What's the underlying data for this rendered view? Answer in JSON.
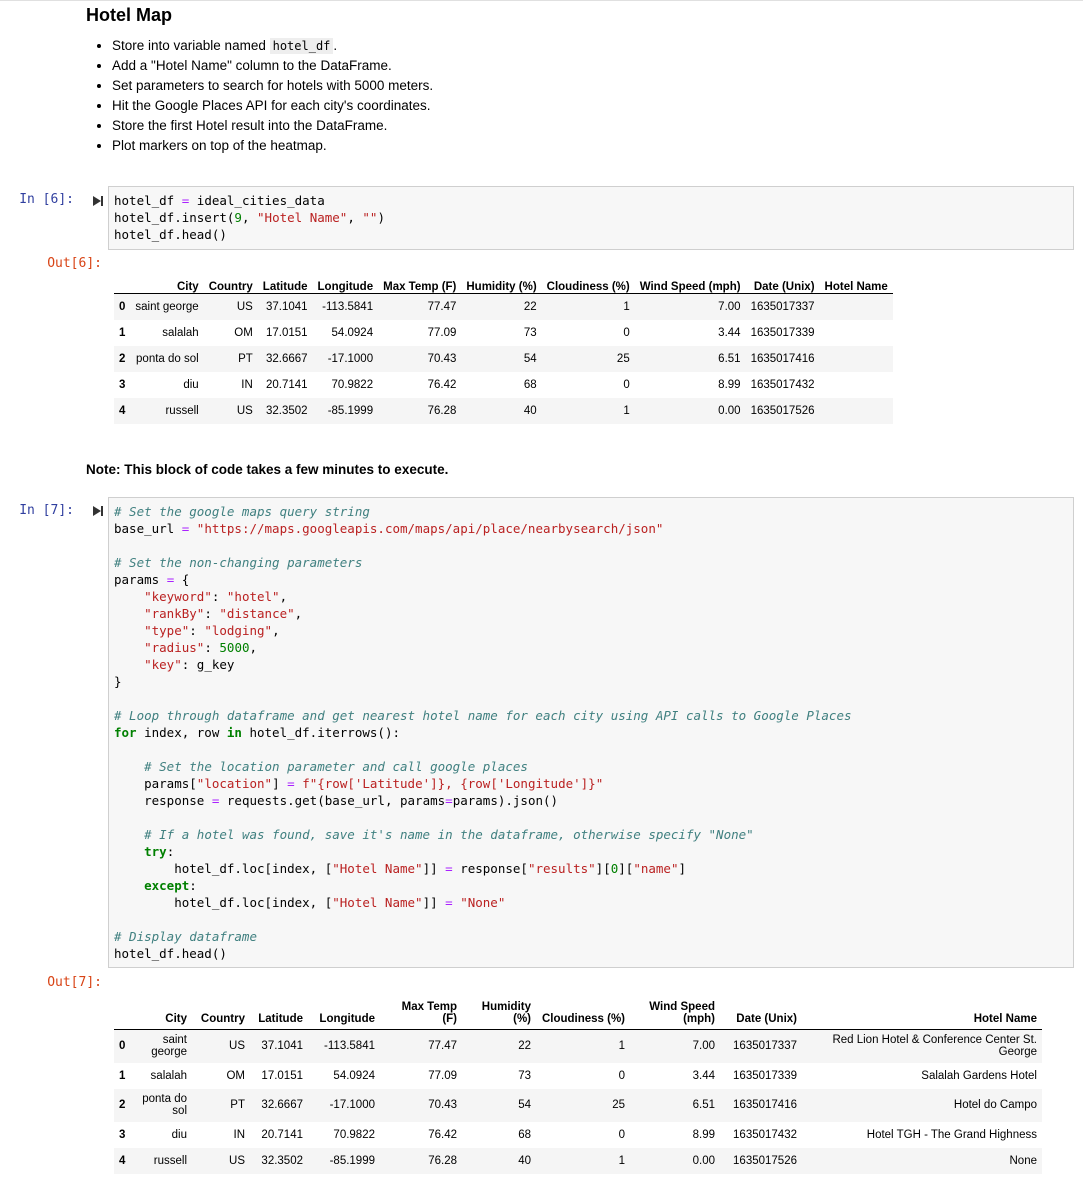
{
  "markdown": {
    "title": "Hotel Map",
    "bullets": [
      {
        "pre": "Store into variable named ",
        "code": "hotel_df",
        "post": "."
      },
      {
        "pre": "Add a \"Hotel Name\" column to the DataFrame.",
        "code": "",
        "post": ""
      },
      {
        "pre": "Set parameters to search for hotels with 5000 meters.",
        "code": "",
        "post": ""
      },
      {
        "pre": "Hit the Google Places API for each city's coordinates.",
        "code": "",
        "post": ""
      },
      {
        "pre": "Store the first Hotel result into the DataFrame.",
        "code": "",
        "post": ""
      },
      {
        "pre": "Plot markers on top of the heatmap.",
        "code": "",
        "post": ""
      }
    ],
    "note": "Note: This block of code takes a few minutes to execute."
  },
  "cells": {
    "in6": "In [6]:",
    "out6": "Out[6]:",
    "in7": "In [7]:",
    "out7": "Out[7]:"
  },
  "code6": [
    "hotel_df = ideal_cities_data",
    "hotel_df.insert(9, \"Hotel Name\", \"\")",
    "hotel_df.head()"
  ],
  "code7": [
    "# Set the google maps query string",
    "base_url = \"https://maps.googleapis.com/maps/api/place/nearbysearch/json\"",
    "",
    "# Set the non-changing parameters",
    "params = {",
    "    \"keyword\": \"hotel\",",
    "    \"rankBy\": \"distance\",",
    "    \"type\": \"lodging\",",
    "    \"radius\": 5000,",
    "    \"key\": g_key",
    "}",
    "",
    "# Loop through dataframe and get nearest hotel name for each city using API calls to Google Places",
    "for index, row in hotel_df.iterrows():",
    "",
    "    # Set the location parameter and call google places",
    "    params[\"location\"] = f\"{row['Latitude']}, {row['Longitude']}\"",
    "    response = requests.get(base_url, params=params).json()",
    "",
    "    # If a hotel was found, save it's name in the dataframe, otherwise specify \"None\"",
    "    try:",
    "        hotel_df.loc[index, [\"Hotel Name\"]] = response[\"results\"][0][\"name\"]",
    "    except:",
    "        hotel_df.loc[index, [\"Hotel Name\"]] = \"None\"",
    "",
    "# Display dataframe",
    "hotel_df.head()"
  ],
  "df1": {
    "columns": [
      "",
      "City",
      "Country",
      "Latitude",
      "Longitude",
      "Max Temp (F)",
      "Humidity (%)",
      "Cloudiness (%)",
      "Wind Speed (mph)",
      "Date (Unix)",
      "Hotel Name"
    ],
    "rows": [
      [
        "0",
        "saint george",
        "US",
        "37.1041",
        "-113.5841",
        "77.47",
        "22",
        "1",
        "7.00",
        "1635017337",
        ""
      ],
      [
        "1",
        "salalah",
        "OM",
        "17.0151",
        "54.0924",
        "77.09",
        "73",
        "0",
        "3.44",
        "1635017339",
        ""
      ],
      [
        "2",
        "ponta do sol",
        "PT",
        "32.6667",
        "-17.1000",
        "70.43",
        "54",
        "25",
        "6.51",
        "1635017416",
        ""
      ],
      [
        "3",
        "diu",
        "IN",
        "20.7141",
        "70.9822",
        "76.42",
        "68",
        "0",
        "8.99",
        "1635017432",
        ""
      ],
      [
        "4",
        "russell",
        "US",
        "32.3502",
        "-85.1999",
        "76.28",
        "40",
        "1",
        "0.00",
        "1635017526",
        ""
      ]
    ]
  },
  "df2": {
    "columns": [
      "",
      "City",
      "Country",
      "Latitude",
      "Longitude",
      "Max Temp (F)",
      "Humidity (%)",
      "Cloudiness (%)",
      "Wind Speed (mph)",
      "Date (Unix)",
      "Hotel Name"
    ],
    "rows": [
      [
        "0",
        "saint george",
        "US",
        "37.1041",
        "-113.5841",
        "77.47",
        "22",
        "1",
        "7.00",
        "1635017337",
        "Red Lion Hotel & Conference Center St. George"
      ],
      [
        "1",
        "salalah",
        "OM",
        "17.0151",
        "54.0924",
        "77.09",
        "73",
        "0",
        "3.44",
        "1635017339",
        "Salalah Gardens Hotel"
      ],
      [
        "2",
        "ponta do sol",
        "PT",
        "32.6667",
        "-17.1000",
        "70.43",
        "54",
        "25",
        "6.51",
        "1635017416",
        "Hotel do Campo"
      ],
      [
        "3",
        "diu",
        "IN",
        "20.7141",
        "70.9822",
        "76.42",
        "68",
        "0",
        "8.99",
        "1635017432",
        "Hotel TGH - The Grand Highness"
      ],
      [
        "4",
        "russell",
        "US",
        "32.3502",
        "-85.1999",
        "76.28",
        "40",
        "1",
        "0.00",
        "1635017526",
        "None"
      ]
    ]
  }
}
